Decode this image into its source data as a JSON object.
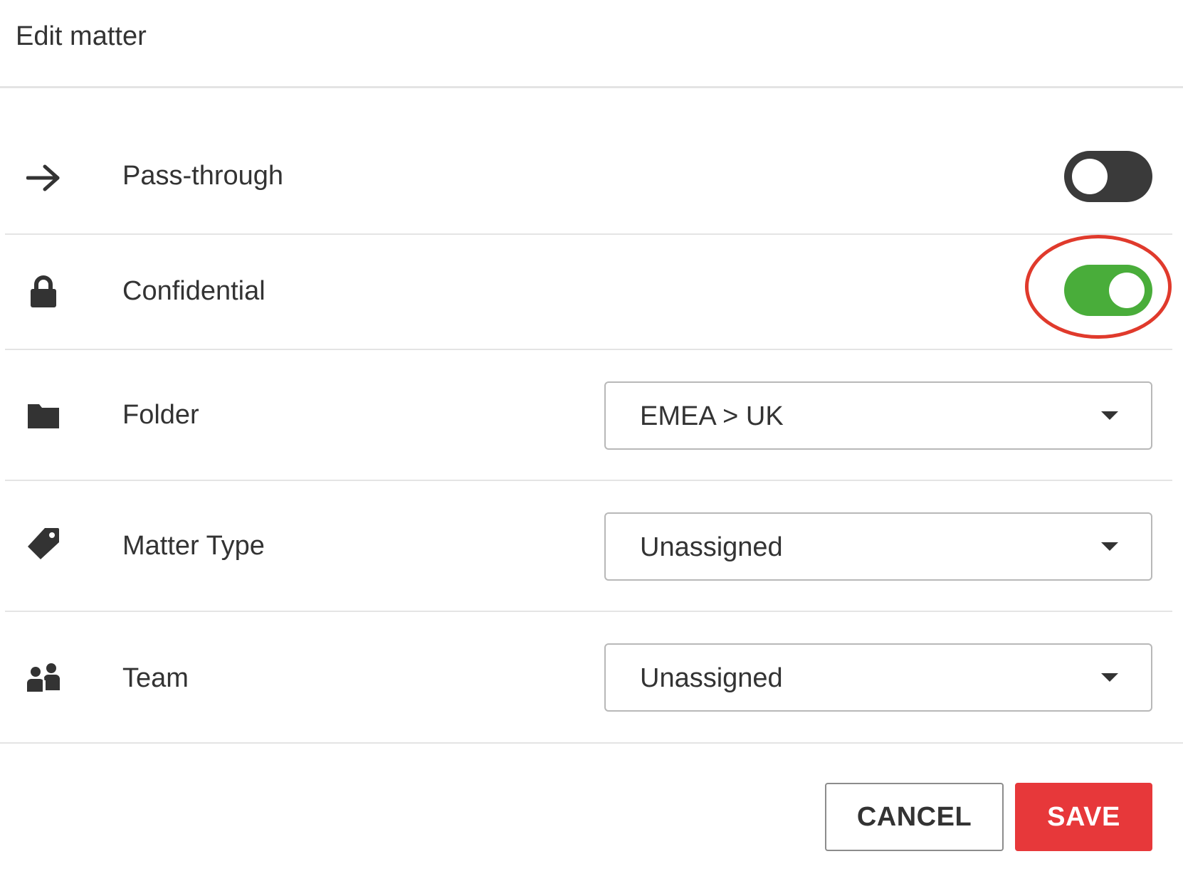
{
  "dialog": {
    "title": "Edit matter"
  },
  "rows": {
    "pass_through": {
      "label": "Pass-through",
      "icon": "arrow-right-icon",
      "toggle_on": false
    },
    "confidential": {
      "label": "Confidential",
      "icon": "lock-icon",
      "toggle_on": true
    },
    "folder": {
      "label": "Folder",
      "icon": "folder-icon",
      "value": "EMEA > UK"
    },
    "matter_type": {
      "label": "Matter Type",
      "icon": "tag-icon",
      "value": "Unassigned"
    },
    "team": {
      "label": "Team",
      "icon": "team-icon",
      "value": "Unassigned"
    }
  },
  "footer": {
    "cancel_label": "CANCEL",
    "save_label": "SAVE"
  },
  "colors": {
    "toggle_on": "#49ad3a",
    "toggle_off": "#3a3a3a",
    "save_button": "#e7383a",
    "highlight_ring": "#e03a2c"
  }
}
